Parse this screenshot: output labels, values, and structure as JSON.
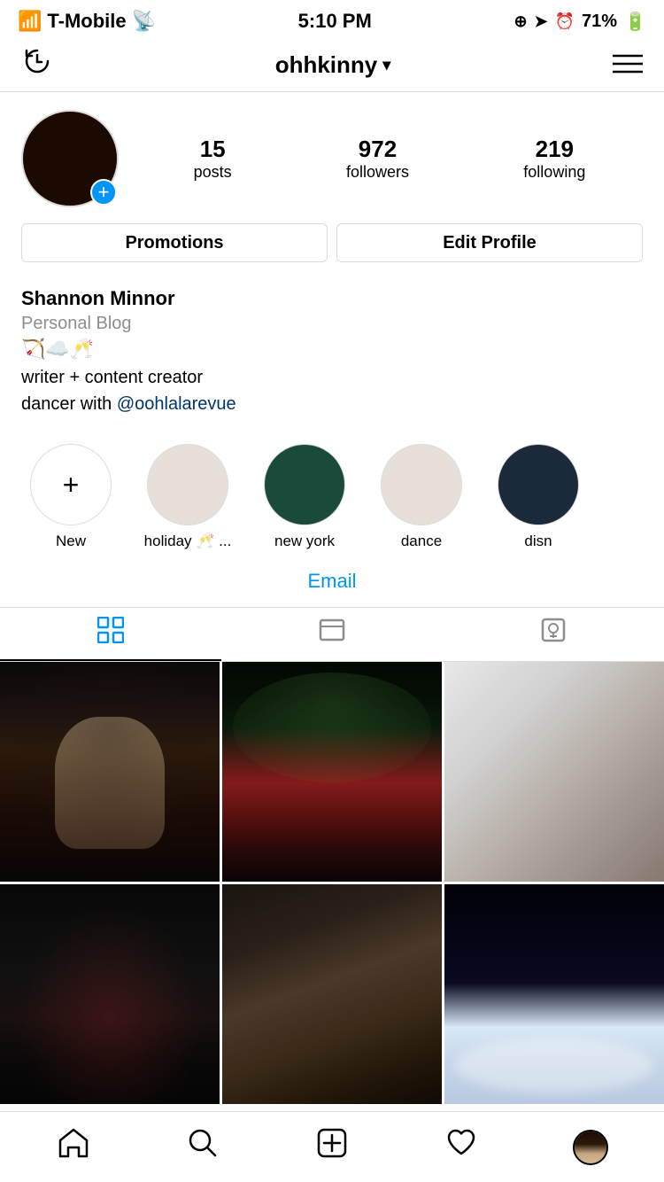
{
  "status": {
    "carrier": "T-Mobile",
    "time": "5:10 PM",
    "battery": "71%",
    "icons": [
      "signal",
      "wifi",
      "location",
      "alarm"
    ]
  },
  "nav": {
    "username": "ohhkinny",
    "chevron": "▾",
    "menu_lines": "☰"
  },
  "profile": {
    "name": "Shannon Minnor",
    "category": "Personal Blog",
    "emojis": "🏹☁️🥂",
    "bio_line1": "writer + content creator",
    "bio_line2": "dancer with ",
    "bio_link": "@oohlalarevue",
    "stats": {
      "posts": {
        "value": "15",
        "label": "posts"
      },
      "followers": {
        "value": "972",
        "label": "followers"
      },
      "following": {
        "value": "219",
        "label": "following"
      }
    },
    "buttons": {
      "promotions": "Promotions",
      "edit_profile": "Edit Profile"
    }
  },
  "stories": [
    {
      "label": "New",
      "type": "new"
    },
    {
      "label": "holiday 🥂 ...",
      "type": "holiday"
    },
    {
      "label": "new york",
      "type": "newyork"
    },
    {
      "label": "dance",
      "type": "dance"
    },
    {
      "label": "disn",
      "type": "disney"
    }
  ],
  "email": {
    "label": "Email"
  },
  "tabs": {
    "grid": "grid",
    "feed": "feed",
    "tagged": "tagged"
  },
  "bottomnav": {
    "home": "🏠",
    "search": "🔍",
    "add": "➕",
    "heart": "♡",
    "profile": "👤"
  }
}
